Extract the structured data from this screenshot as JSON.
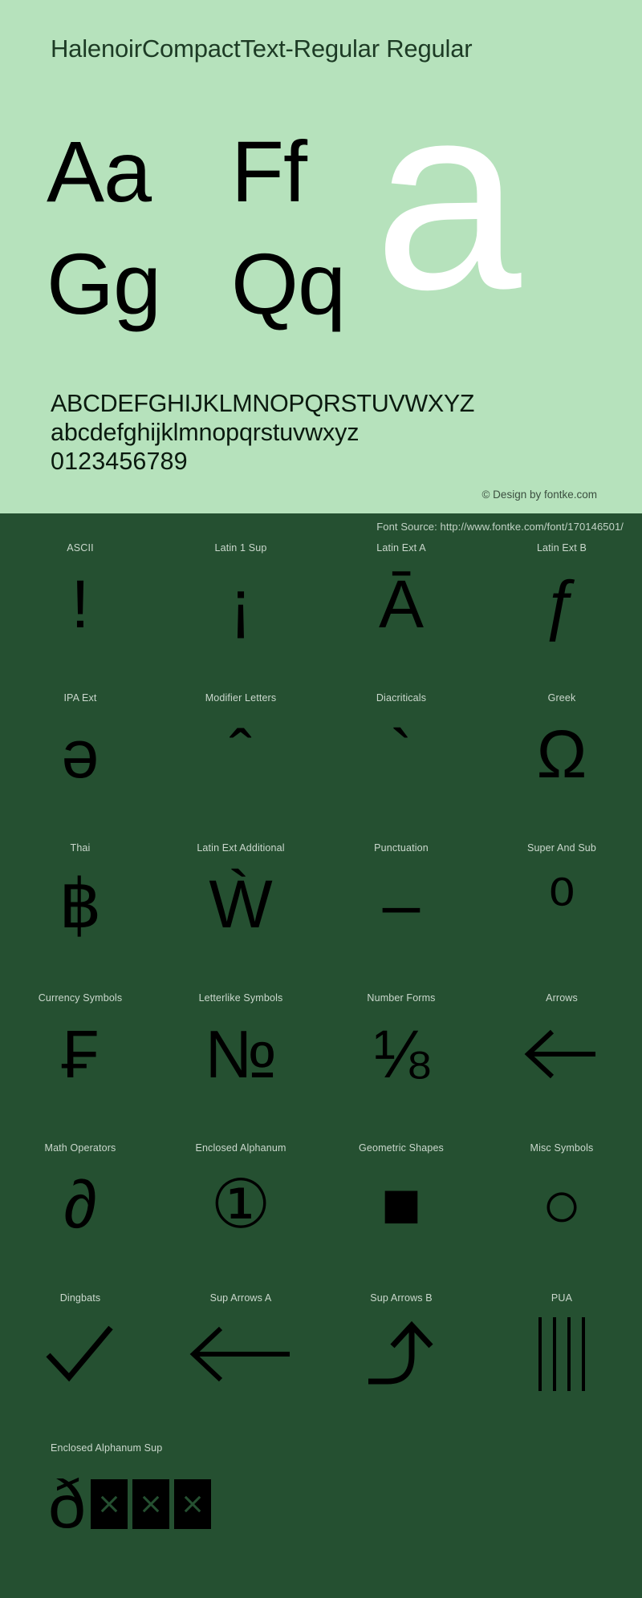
{
  "header": {
    "title": "HalenoirCompactText-Regular Regular"
  },
  "specimen": {
    "pairs": [
      "Aa",
      "Ff",
      "Gg",
      "Qq"
    ],
    "big_letter": "a",
    "uppercase": "ABCDEFGHIJKLMNOPQRSTUVWXYZ",
    "lowercase": "abcdefghijklmnopqrstuvwxyz",
    "digits": "0123456789",
    "credit": "© Design by fontke.com"
  },
  "glyph_panel": {
    "font_source": "Font Source: http://www.fontke.com/font/170146501/",
    "rows": [
      [
        {
          "label": "ASCII",
          "glyph": "!"
        },
        {
          "label": "Latin 1 Sup",
          "glyph": "¡"
        },
        {
          "label": "Latin Ext A",
          "glyph": "Ā"
        },
        {
          "label": "Latin Ext B",
          "glyph": "ƒ"
        }
      ],
      [
        {
          "label": "IPA Ext",
          "glyph": "ə"
        },
        {
          "label": "Modifier Letters",
          "glyph": "ˆ"
        },
        {
          "label": "Diacriticals",
          "glyph": "`"
        },
        {
          "label": "Greek",
          "glyph": "Ω"
        }
      ],
      [
        {
          "label": "Thai",
          "glyph": "฿"
        },
        {
          "label": "Latin Ext Additional",
          "glyph": "Ẁ"
        },
        {
          "label": "Punctuation",
          "glyph": "–"
        },
        {
          "label": "Super And Sub",
          "glyph": "⁰"
        }
      ],
      [
        {
          "label": "Currency Symbols",
          "glyph": "₣"
        },
        {
          "label": "Letterlike Symbols",
          "glyph": "№"
        },
        {
          "label": "Number Forms",
          "glyph": "⅛"
        },
        {
          "label": "Arrows",
          "glyph": "←"
        }
      ],
      [
        {
          "label": "Math Operators",
          "glyph": "∂"
        },
        {
          "label": "Enclosed Alphanum",
          "glyph": "①"
        },
        {
          "label": "Geometric Shapes",
          "glyph": "■"
        },
        {
          "label": "Misc Symbols",
          "glyph": "○"
        }
      ],
      [
        {
          "label": "Dingbats",
          "glyph": "✓"
        },
        {
          "label": "Sup Arrows A",
          "glyph": "⟵"
        },
        {
          "label": "Sup Arrows B",
          "glyph": "⤴"
        },
        {
          "label": "PUA",
          "glyph": "||||"
        }
      ],
      [
        {
          "label": "Enclosed Alphanum Sup",
          "glyph": "ð□□□"
        }
      ]
    ]
  },
  "colors": {
    "light_green": "#b6e2bc",
    "dark_green": "#255031",
    "glyph_black": "#000000",
    "label_gray": "#cbd8cd",
    "title_green": "#1d3b25",
    "white": "#ffffff"
  }
}
